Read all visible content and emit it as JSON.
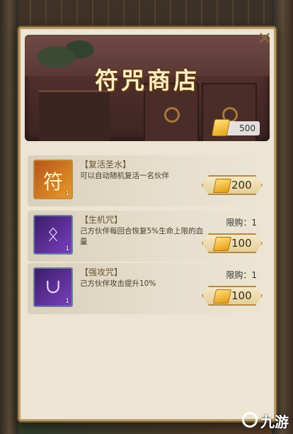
{
  "shop": {
    "title": "符咒商店",
    "currency_amount": "500",
    "close_icon": "close-icon"
  },
  "items": [
    {
      "name": "【复活圣水】",
      "desc": "可以自动随机复活一名伙伴",
      "limit": "",
      "price": "200",
      "count": "1",
      "icon": "holy-water-talisman-icon",
      "icon_glyph": "符",
      "icon_color": "#e08a2a"
    },
    {
      "name": "【生机咒】",
      "desc": "己方伙伴每回合恢复5%生命上限的血量",
      "limit": "限购：1",
      "price": "100",
      "count": "1",
      "icon": "vitality-curse-icon",
      "icon_glyph": "ᛟ",
      "icon_color": "#7a3ec0"
    },
    {
      "name": "【强攻咒】",
      "desc": "己方伙伴攻击提升10%",
      "limit": "限购：1",
      "price": "100",
      "count": "1",
      "icon": "power-attack-curse-icon",
      "icon_glyph": "∪",
      "icon_color": "#7a3ec0"
    }
  ],
  "watermark": "九游"
}
